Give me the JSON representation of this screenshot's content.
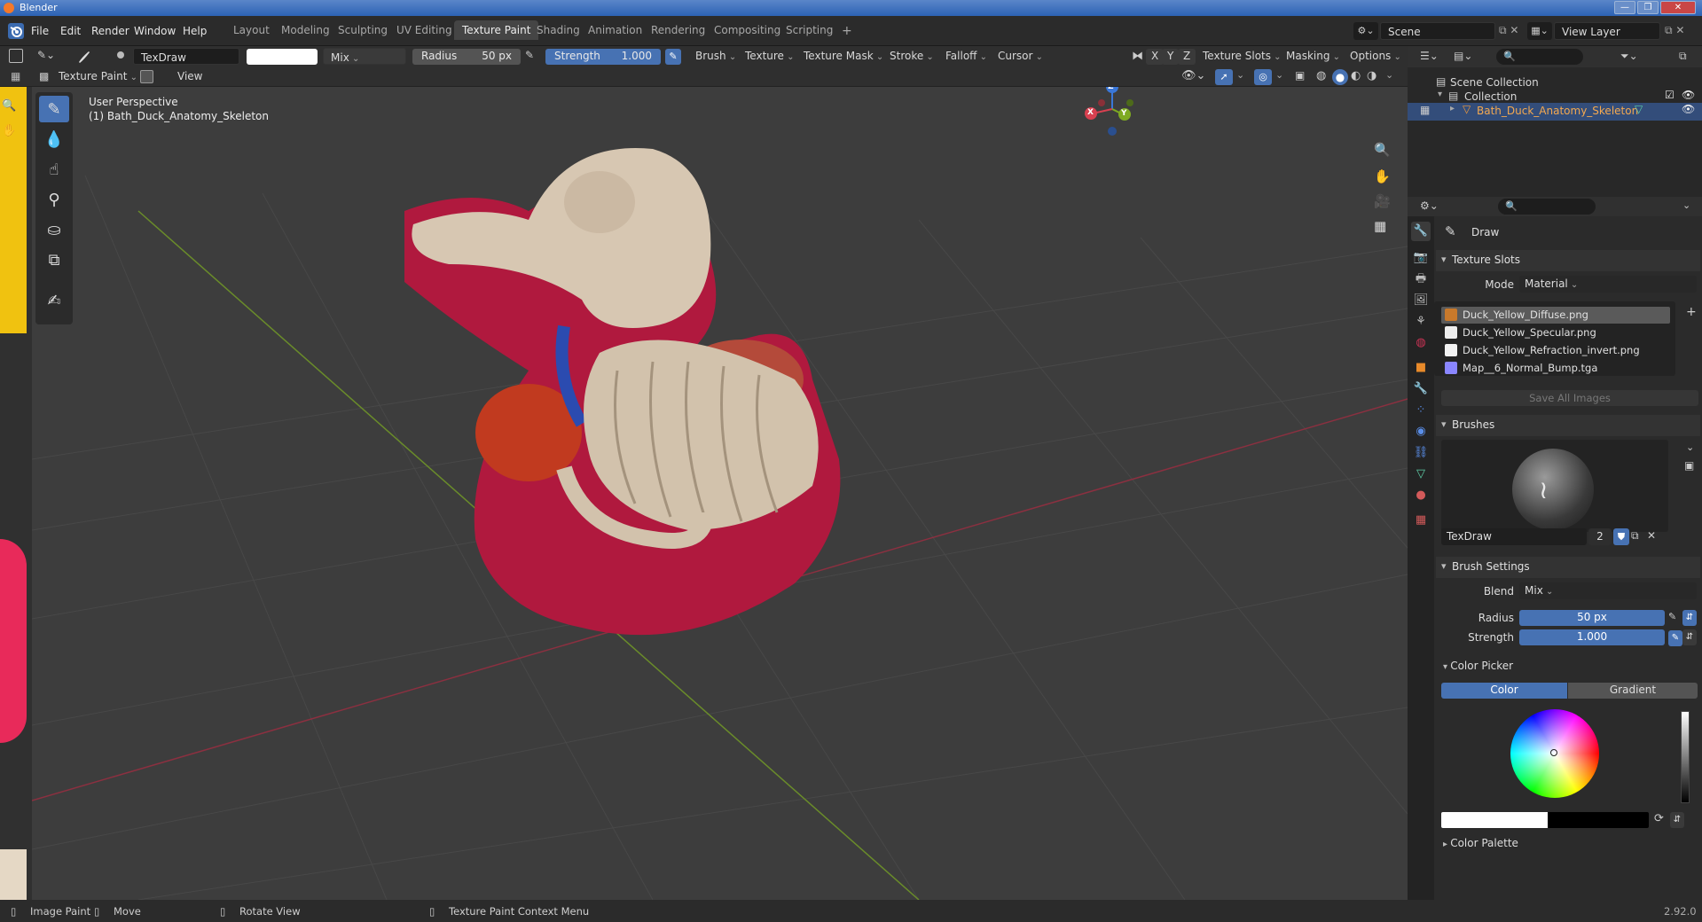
{
  "window": {
    "title": "Blender",
    "buttons": [
      "—",
      "❐",
      "✕"
    ]
  },
  "menu": [
    "File",
    "Edit",
    "Render",
    "Window",
    "Help"
  ],
  "workspaces": [
    "Layout",
    "Modeling",
    "Sculpting",
    "UV Editing",
    "Texture Paint",
    "Shading",
    "Animation",
    "Rendering",
    "Compositing",
    "Scripting"
  ],
  "active_workspace": "Texture Paint",
  "add_workspace": "+",
  "scene": {
    "label": "Scene",
    "view_layer": "View Layer"
  },
  "tool_header": {
    "brush_name": "TexDraw",
    "blend": "Mix",
    "radius_label": "Radius",
    "radius_value": "50 px",
    "strength_label": "Strength",
    "strength_value": "1.000",
    "menus": [
      "Brush",
      "Texture",
      "Texture Mask",
      "Stroke",
      "Falloff",
      "Cursor"
    ],
    "axes": [
      "X",
      "Y",
      "Z"
    ],
    "right_menus": [
      "Texture Slots",
      "Masking",
      "Options"
    ]
  },
  "mode_header": {
    "mode": "Texture Paint",
    "view": "View"
  },
  "viewport": {
    "perspective": "User Perspective",
    "object": "(1) Bath_Duck_Anatomy_Skeleton",
    "gizmo": {
      "x": "X",
      "y": "Y",
      "z": "Z"
    }
  },
  "outliner": {
    "scene_collection": "Scene Collection",
    "collection": "Collection",
    "object": "Bath_Duck_Anatomy_Skeleton"
  },
  "properties": {
    "tool_name": "Draw",
    "texture_slots": {
      "title": "Texture Slots",
      "mode_label": "Mode",
      "mode_value": "Material",
      "slots": [
        {
          "name": "Duck_Yellow_Diffuse.png",
          "color": "#c8792b"
        },
        {
          "name": "Duck_Yellow_Specular.png",
          "color": "#eeeeee"
        },
        {
          "name": "Duck_Yellow_Refraction_invert.png",
          "color": "#f2f2f2"
        },
        {
          "name": "Map__6_Normal_Bump.tga",
          "color": "#8a86ff"
        }
      ],
      "save_all": "Save All Images"
    },
    "brushes": {
      "title": "Brushes",
      "brush_name": "TexDraw",
      "users": "2"
    },
    "brush_settings": {
      "title": "Brush Settings",
      "blend_label": "Blend",
      "blend_value": "Mix",
      "radius_label": "Radius",
      "radius_value": "50 px",
      "strength_label": "Strength",
      "strength_value": "1.000"
    },
    "color_picker": {
      "title": "Color Picker",
      "tab_color": "Color",
      "tab_gradient": "Gradient"
    },
    "color_palette": {
      "title": "Color Palette"
    }
  },
  "statusbar": {
    "items": [
      "Image Paint",
      "Move",
      "Rotate View",
      "Texture Paint Context Menu"
    ],
    "version": "2.92.0"
  },
  "colors": {
    "accent": "#4772b3",
    "viewport_bg": "#3d3d3d",
    "panel_bg": "#2b2b2b",
    "grid_x": "#8b3040",
    "grid_y": "#6a8c2a"
  }
}
